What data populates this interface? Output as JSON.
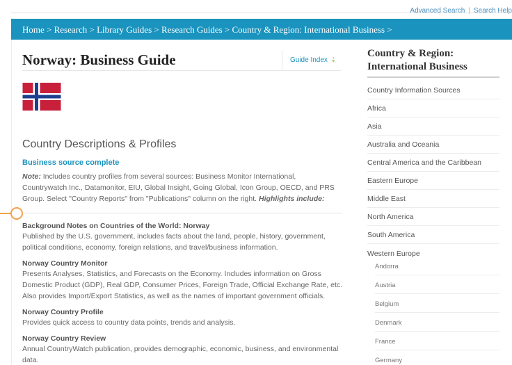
{
  "top_links": {
    "advanced_search": "Advanced Search",
    "separator": "|",
    "search_help": "Search Help"
  },
  "breadcrumb": "Home > Research > Library Guides > Research Guides > Country & Region: International Business >",
  "page": {
    "title": "Norway: Business Guide",
    "guide_index": "Guide Index",
    "guide_index_arrow": "⇣",
    "flag_colors": {
      "red": "#c8203b",
      "white": "#ffffff",
      "blue": "#1d3f8f"
    }
  },
  "section": {
    "title": "Country Descriptions & Profiles",
    "link": "Business source complete",
    "note_label": "Note:",
    "note_text": " Includes country profiles from several sources: Business Monitor International, Countrywatch Inc., Datamonitor, EIU, Global Insight, Going Global, Icon Group, OECD, and PRS Group. Select \"Country Reports\" from \"Publications\" column on the right. ",
    "note_highlight": "Highlights include:"
  },
  "entries": [
    {
      "title": "Background Notes on Countries of the World: Norway",
      "desc": "Published by the U.S. government, includes facts about the land, people, history, government, political conditions, economy, foreign relations, and travel/business information."
    },
    {
      "title": "Norway Country Monitor",
      "desc": "Presents Analyses, Statistics, and Forecasts on the Economy. Includes information on Gross Domestic Product (GDP), Real GDP, Consumer Prices, Foreign Trade, Official Exchange Rate, etc. Also provides Import/Export Statistics, as well as the names of important government officials."
    },
    {
      "title": "Norway Country Profile",
      "desc": "Provides quick access to country data points, trends and analysis."
    },
    {
      "title": "Norway Country Review",
      "desc": "Annual CountryWatch publication, provides demographic, economic, business, and environmental data."
    }
  ],
  "sidebar": {
    "title": "Country & Region: International Business",
    "items": [
      "Country Information Sources",
      "Africa",
      "Asia",
      "Australia and Oceania",
      "Central America and the Caribbean",
      "Eastern Europe",
      "Middle East",
      "North America",
      "South America",
      "Western Europe"
    ],
    "sub_items": [
      "Andorra",
      "Austria",
      "Belgium",
      "Denmark",
      "France",
      "Germany"
    ]
  },
  "colors": {
    "accent": "#1a93be",
    "marker": "#f4a14a",
    "link_green": "#8cc63f"
  }
}
